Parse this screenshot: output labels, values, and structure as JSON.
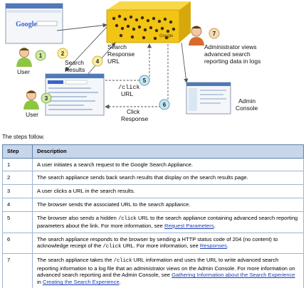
{
  "diagram": {
    "labels": {
      "user_top": "User",
      "user_bottom": "User",
      "search_results": [
        "Search",
        "Results"
      ],
      "search_response_url": [
        "Search",
        "Response",
        "URL"
      ],
      "click_url": [
        "/click",
        "URL"
      ],
      "click_response": [
        "Click",
        "Response"
      ],
      "admin_views": [
        "Administrator views",
        "advanced search",
        "reporting data in logs"
      ],
      "admin_console": [
        "Admin",
        "Console"
      ],
      "google_logo": "Google",
      "appliance_brand": "Google"
    },
    "step_numbers": [
      "1",
      "2",
      "3",
      "4",
      "5",
      "6",
      "7"
    ],
    "colors": {
      "appliance": "#f2c414",
      "user_circle": "#cfe9a8",
      "user_circle_stroke": "#7fb548",
      "results_circle": "#fbeea5",
      "results_circle_stroke": "#d6b42a",
      "click_circle": "#c9e6f2",
      "click_circle_stroke": "#5aa0c2",
      "admin_circle": "#f6dcb8",
      "admin_circle_stroke": "#c99a52"
    }
  },
  "intro": "The steps follow.",
  "table": {
    "headers": [
      "Step",
      "Description"
    ],
    "rows": [
      {
        "step": "1",
        "parts": [
          {
            "t": "A user initiates a search request to the Google Search Appliance."
          }
        ]
      },
      {
        "step": "2",
        "parts": [
          {
            "t": "The search appliance sends back search results that display on the search results page."
          }
        ]
      },
      {
        "step": "3",
        "parts": [
          {
            "t": "A user clicks a URL in the search results."
          }
        ]
      },
      {
        "step": "4",
        "parts": [
          {
            "t": "The browser sends the associated URL to the search appliance."
          }
        ]
      },
      {
        "step": "5",
        "parts": [
          {
            "t": "The browser also sends a hidden "
          },
          {
            "t": "/click",
            "code": true
          },
          {
            "t": " URL to the search appliance containing advanced search reporting parameters about the link. For more information, see "
          },
          {
            "t": "Request Parameters",
            "link": true
          },
          {
            "t": "."
          }
        ]
      },
      {
        "step": "6",
        "parts": [
          {
            "t": "The search appliance responds to the browser by sending a HTTP status code of 204 (no content) to acknowledge receipt of the "
          },
          {
            "t": "/click",
            "code": true
          },
          {
            "t": " URL. For more information, see "
          },
          {
            "t": "Responses",
            "link": true
          },
          {
            "t": "."
          }
        ]
      },
      {
        "step": "7",
        "parts": [
          {
            "t": "The search appliance takes the "
          },
          {
            "t": "/click",
            "code": true
          },
          {
            "t": " URL information and uses the URL to write advanced search reporting information to a log file that an administrator views on the Admin Console. For more information on advanced search reporting and the Admin Console, see "
          },
          {
            "t": "Gathering Information about the Search Experience",
            "link": true
          },
          {
            "t": " in "
          },
          {
            "t": "Creating the Search Experience",
            "link": true
          },
          {
            "t": "."
          }
        ]
      }
    ]
  }
}
